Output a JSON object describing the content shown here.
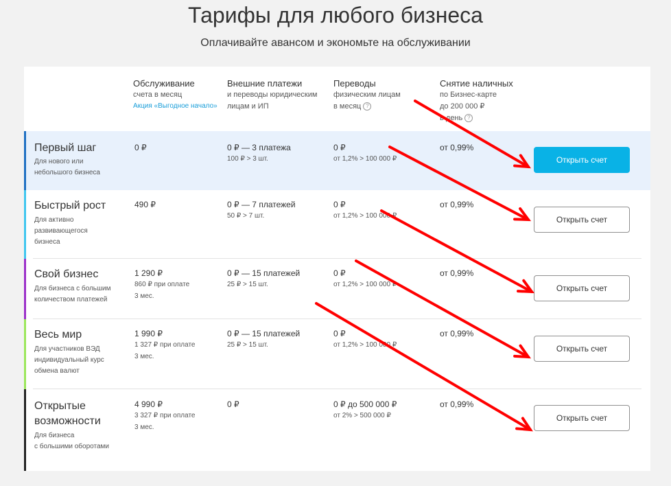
{
  "header": {
    "title": "Тарифы для любого бизнеса",
    "subtitle": "Оплачивайте авансом и экономьте на обслуживании"
  },
  "columns": {
    "service": {
      "title": "Обслуживание",
      "sub": "счета в месяц",
      "promo": "Акция «Выгодное начало»"
    },
    "payments": {
      "title": "Внешние платежи",
      "sub1": "и переводы юридическим",
      "sub2": "лицам и ИП"
    },
    "transfers": {
      "title": "Переводы",
      "sub1": "физическим лицам",
      "sub2": "в месяц"
    },
    "cash": {
      "title": "Снятие наличных",
      "sub1": "по Бизнес-карте",
      "sub2": "до 200 000 ₽",
      "sub3": "в день"
    }
  },
  "tariffs": [
    {
      "name": "Первый шаг",
      "desc": [
        "Для нового или",
        "небольшого бизнеса"
      ],
      "service": {
        "main": "0 ₽",
        "notes": []
      },
      "payments": {
        "main": "0 ₽ — 3 платежа",
        "note": "100 ₽ > 3 шт."
      },
      "transfers": {
        "main": "0 ₽",
        "note": "от 1,2% > 100 000 ₽"
      },
      "cash": "от 0,99%",
      "button": "Открыть счет",
      "stripe_color": "#1e6fc2",
      "highlight": true
    },
    {
      "name": "Быстрый рост",
      "desc": [
        "Для активно",
        "развивающегося",
        "бизнеса"
      ],
      "service": {
        "main": "490 ₽",
        "notes": []
      },
      "payments": {
        "main": "0 ₽ — 7 платежей",
        "note": "50 ₽ > 7 шт."
      },
      "transfers": {
        "main": "0 ₽",
        "note": "от 1,2% > 100 000 ₽"
      },
      "cash": "от 0,99%",
      "button": "Открыть счет",
      "stripe_color": "#3ec6ef",
      "highlight": false
    },
    {
      "name": "Свой бизнес",
      "desc": [
        "Для бизнеса с большим",
        "количеством платежей"
      ],
      "service": {
        "main": "1 290 ₽",
        "notes": [
          "860 ₽ при оплате",
          "3 мес."
        ]
      },
      "payments": {
        "main": "0 ₽ — 15 платежей",
        "note": "25 ₽ > 15 шт."
      },
      "transfers": {
        "main": "0 ₽",
        "note": "от 1,2% > 100 000 ₽"
      },
      "cash": "от 0,99%",
      "button": "Открыть счет",
      "stripe_color": "#9b2fc9",
      "highlight": false
    },
    {
      "name": "Весь мир",
      "desc": [
        "Для участников ВЭД",
        "индивидуальный курс",
        "обмена валют"
      ],
      "service": {
        "main": "1 990 ₽",
        "notes": [
          "1 327 ₽ при оплате",
          "3 мес."
        ]
      },
      "payments": {
        "main": "0 ₽ — 15 платежей",
        "note": "25 ₽ > 15 шт."
      },
      "transfers": {
        "main": "0 ₽",
        "note": "от 1,2% > 100 000 ₽"
      },
      "cash": "от 0,99%",
      "button": "Открыть счет",
      "stripe_color": "#9be75a",
      "highlight": false
    },
    {
      "name": "Открытые возможности",
      "desc": [
        "Для бизнеса",
        "с большими оборотами"
      ],
      "service": {
        "main": "4 990 ₽",
        "notes": [
          "3 327 ₽ при оплате",
          "3 мес."
        ]
      },
      "payments": {
        "main": "0 ₽",
        "note": ""
      },
      "transfers": {
        "main": "0 ₽ до 500 000 ₽",
        "note": "от 2% > 500 000 ₽"
      },
      "cash": "от 0,99%",
      "button": "Открыть счет",
      "stripe_color": "#222222",
      "highlight": false
    }
  ],
  "annotation_color": "#ff0000"
}
